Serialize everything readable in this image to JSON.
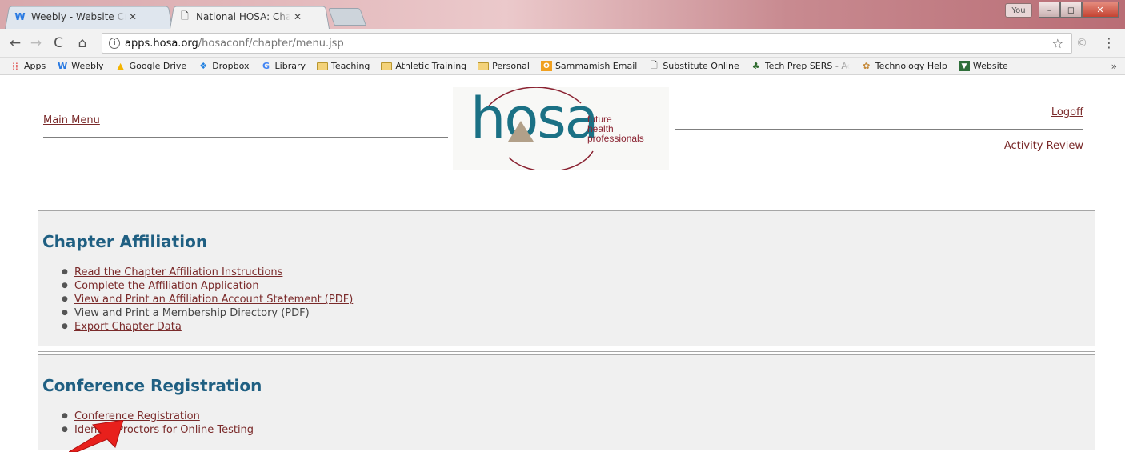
{
  "browser": {
    "tabs": [
      {
        "title": "Weebly - Website Creati",
        "favicon": "weebly-icon",
        "active": false
      },
      {
        "title": "National HOSA: Chapter",
        "favicon": "page-icon",
        "active": true
      }
    ],
    "window_user_label": "You",
    "address": {
      "host": "apps.hosa.org",
      "path": "/hosaconf/chapter/menu.jsp"
    },
    "bookmarks": [
      {
        "label": "Apps",
        "icon": "apps-grid-icon"
      },
      {
        "label": "Weebly",
        "icon": "weebly-icon"
      },
      {
        "label": "Google Drive",
        "icon": "google-drive-icon"
      },
      {
        "label": "Dropbox",
        "icon": "dropbox-icon"
      },
      {
        "label": "Library",
        "icon": "google-icon"
      },
      {
        "label": "Teaching",
        "icon": "folder-icon"
      },
      {
        "label": "Athletic Training",
        "icon": "folder-icon"
      },
      {
        "label": "Personal",
        "icon": "folder-icon"
      },
      {
        "label": "Sammamish Email",
        "icon": "outlook-icon"
      },
      {
        "label": "Substitute Online",
        "icon": "page-icon"
      },
      {
        "label": "Tech Prep SERS - Adm",
        "icon": "plant-icon"
      },
      {
        "label": "Technology Help",
        "icon": "palette-icon"
      },
      {
        "label": "Website",
        "icon": "website-icon"
      }
    ],
    "more_bookmarks": "»"
  },
  "header": {
    "main_menu": "Main Menu",
    "logoff": "Logoff",
    "activity_review": "Activity Review",
    "logo": {
      "wordmark": "hosa",
      "tagline": [
        "future",
        "health",
        "professionals"
      ]
    }
  },
  "sections": [
    {
      "title": "Chapter Affiliation",
      "items": [
        {
          "label": "Read the Chapter Affiliation Instructions",
          "link": true
        },
        {
          "label": "Complete the Affiliation Application",
          "link": true
        },
        {
          "label": "View and Print an Affiliation Account Statement (PDF)",
          "link": true
        },
        {
          "label": "View and Print a Membership Directory (PDF)",
          "link": false
        },
        {
          "label": "Export Chapter Data",
          "link": true
        }
      ]
    },
    {
      "title": "Conference Registration",
      "items": [
        {
          "label": "Conference Registration",
          "link": true
        },
        {
          "label": "Identify Proctors for Online Testing",
          "link": true
        }
      ]
    }
  ],
  "colors": {
    "heading": "#1f5f82",
    "link": "#7a2a2a",
    "annotation_arrow": "#e8201c",
    "logo_teal": "#1b7185",
    "logo_red": "#8a2231"
  }
}
